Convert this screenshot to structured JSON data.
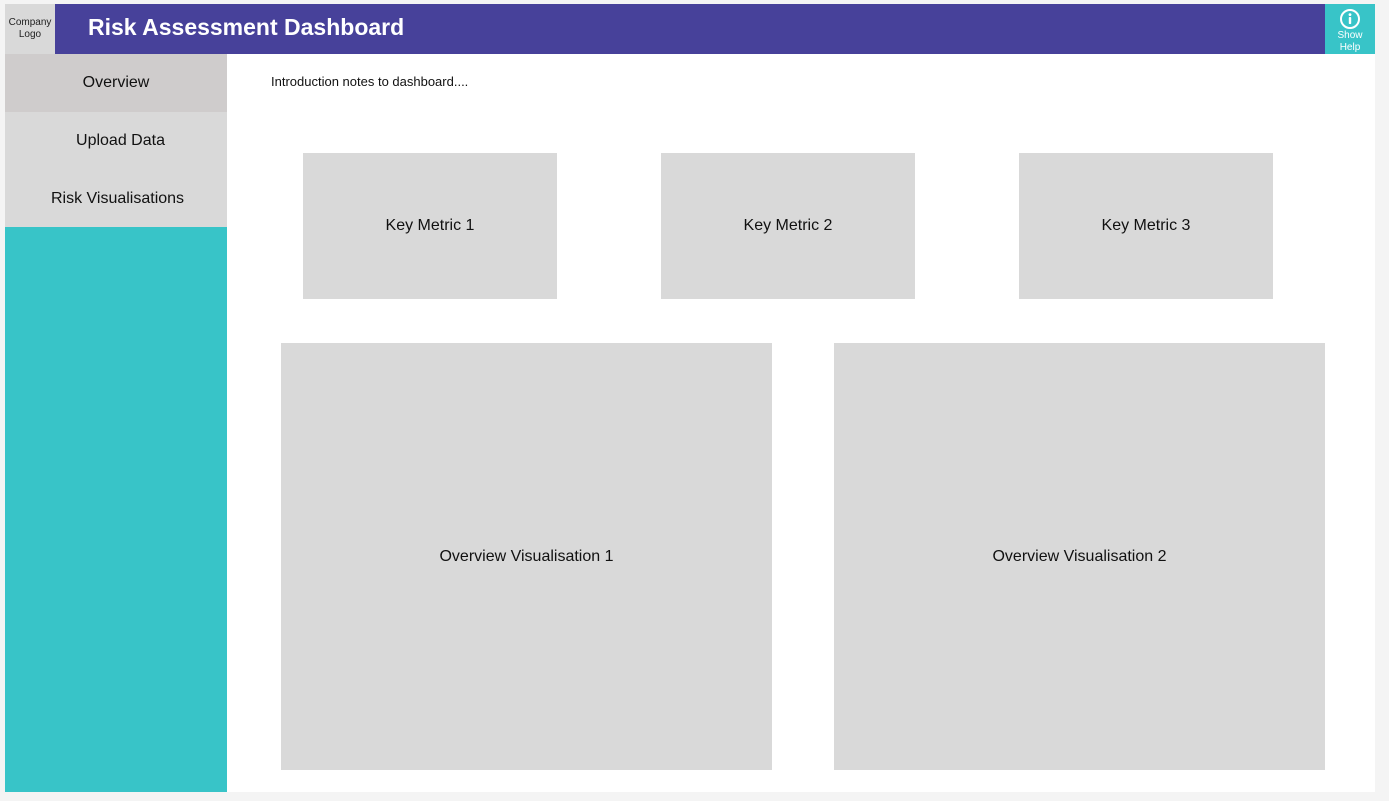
{
  "header": {
    "logo_text": "Company\nLogo",
    "title": "Risk Assessment Dashboard",
    "help_label": "Show\nHelp",
    "help_icon": "info-icon"
  },
  "sidebar": {
    "items": [
      {
        "label": "Overview",
        "active": true
      },
      {
        "label": "Upload Data",
        "active": false
      },
      {
        "label": "Risk Visualisations",
        "active": false
      }
    ]
  },
  "main": {
    "intro": "Introduction notes to dashboard....",
    "metrics": [
      {
        "label": "Key Metric 1"
      },
      {
        "label": "Key Metric 2"
      },
      {
        "label": "Key Metric 3"
      }
    ],
    "visualisations": [
      {
        "label": "Overview Visualisation 1"
      },
      {
        "label": "Overview Visualisation 2"
      }
    ]
  },
  "colors": {
    "header": "#47419a",
    "accent": "#38c4c8",
    "active_nav": "#cfcccc",
    "nav": "#d9d9d9",
    "placeholder": "#d9d9d9",
    "background": "#ffffff"
  }
}
